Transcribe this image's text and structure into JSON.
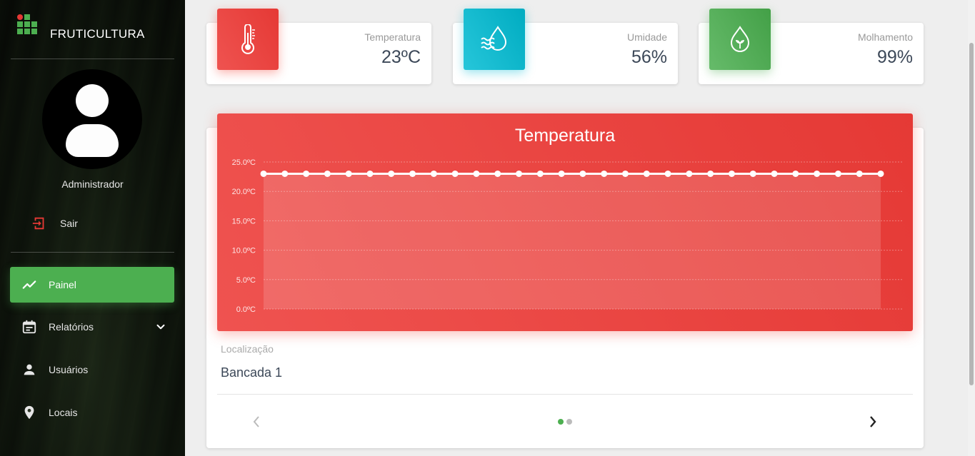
{
  "sidebar": {
    "brand": "FRUTICULTURA",
    "user_name": "Administrador",
    "logout_label": "Sair",
    "items": [
      {
        "label": "Painel",
        "icon": "trending-up-icon",
        "active": true
      },
      {
        "label": "Relatórios",
        "icon": "calendar-icon",
        "active": false
      },
      {
        "label": "Usuários",
        "icon": "person-icon",
        "active": false
      },
      {
        "label": "Locais",
        "icon": "location-pin-icon",
        "active": false
      }
    ]
  },
  "stats": [
    {
      "label": "Temperatura",
      "value": "23ºC",
      "icon": "thermometer-icon",
      "color": "#e53935"
    },
    {
      "label": "Umidade",
      "value": "56%",
      "icon": "water-drop-waves-icon",
      "color": "#00acc1"
    },
    {
      "label": "Molhamento",
      "value": "99%",
      "icon": "leaf-drop-icon",
      "color": "#43a047"
    }
  ],
  "chart_card": {
    "location_label": "Localização",
    "location_value": "Bancada 1",
    "pager_dots": 2,
    "pager_active": 0
  },
  "chart_data": {
    "type": "area",
    "title": "Temperatura",
    "ylim": [
      0,
      25
    ],
    "y_ticks": [
      "0.0ºC",
      "5.0ºC",
      "10.0ºC",
      "15.0ºC",
      "20.0ºC",
      "25.0ºC"
    ],
    "values": [
      23,
      23,
      23,
      23,
      23,
      23,
      23,
      23,
      23,
      23,
      23,
      23,
      23,
      23,
      23,
      23,
      23,
      23,
      23,
      23,
      23,
      23,
      23,
      23,
      23,
      23,
      23,
      23,
      23,
      23
    ],
    "grid": true,
    "color": "#ffffff"
  }
}
